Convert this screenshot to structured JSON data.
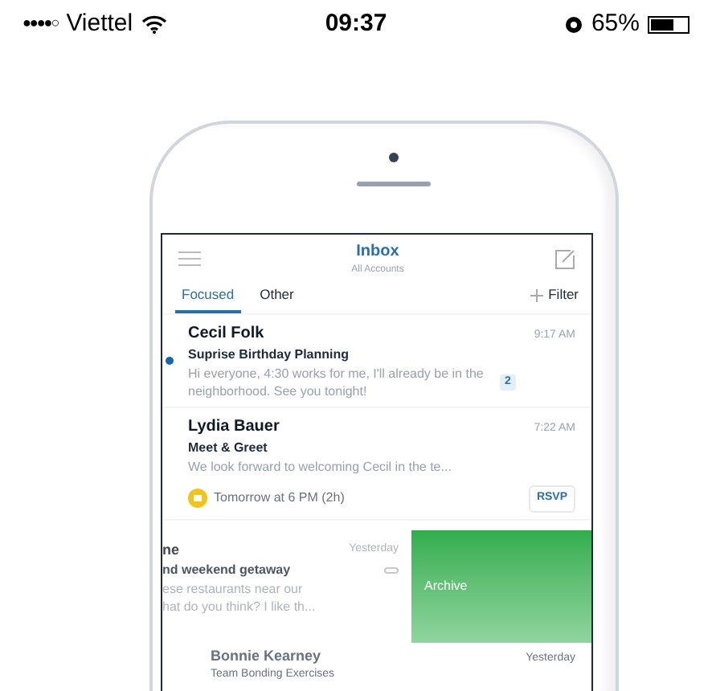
{
  "status_bar": {
    "signal_dots": "●●●●○",
    "carrier": "Viettel",
    "time": "09:37",
    "battery_percent": "65%",
    "battery": {
      "level": 0.65
    }
  },
  "inbox": {
    "header": {
      "title": "Inbox",
      "subtitle": "All Accounts"
    },
    "tabs": [
      {
        "label": "Focused",
        "selected": true
      },
      {
        "label": "Other",
        "selected": false
      }
    ],
    "filter": "Filter",
    "messages": [
      {
        "kind": "normal",
        "sender": "Cecil Folk",
        "time": "9:17 AM",
        "subject": "Suprise Birthday Planning",
        "preview": "Hi everyone, 4:30 works for me, I'll already be in the neighborhood. See you tonight!",
        "unread": true,
        "count": "2"
      },
      {
        "kind": "event",
        "sender": "Lydia Bauer",
        "time": "7:22 AM",
        "subject": "Meet & Greet",
        "preview": "We look forward to welcoming Cecil in the te...",
        "unread": false,
        "event": "Tomorrow at 6 PM (2h)",
        "action": "RSVP"
      },
      {
        "kind": "swiped",
        "sender": "ne",
        "time": "Yesterday",
        "subject": "nd weekend getaway",
        "preview_lines": [
          "ese restaurants near our",
          "hat do you think? I like th..."
        ],
        "unread": false,
        "swipe_action": "Archive"
      },
      {
        "kind": "faded",
        "sender": "Bonnie Kearney",
        "time": "Yesterday",
        "subject": "Team Bonding Exercises",
        "unread": false
      }
    ]
  }
}
